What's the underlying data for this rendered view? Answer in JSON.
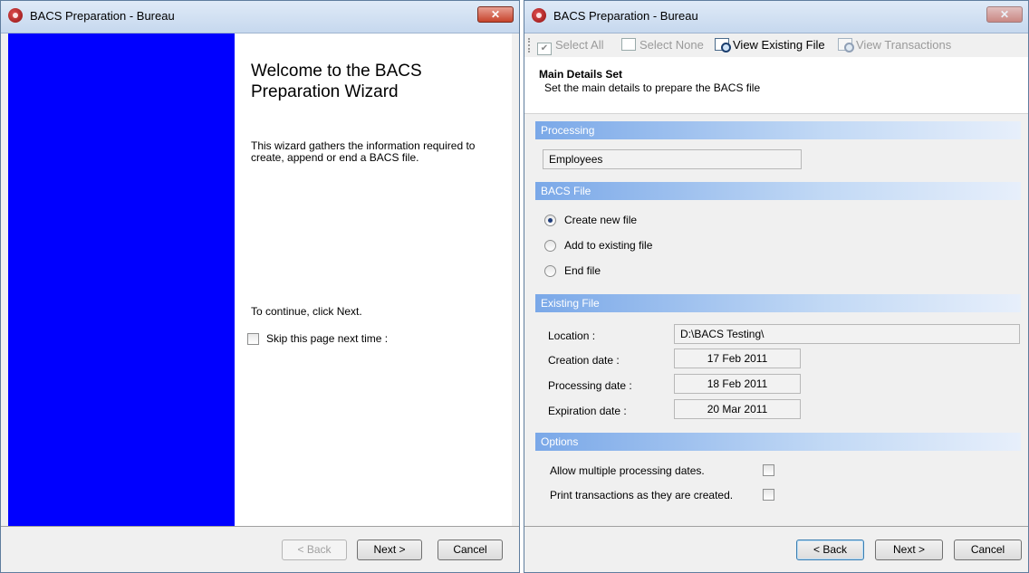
{
  "left_window": {
    "title": "BACS Preparation - Bureau",
    "close_label": "✕",
    "wizard_title": "Welcome to the BACS Preparation Wizard",
    "description": "This wizard gathers the information required to create, append or end a BACS file.",
    "continue_text": "To continue, click Next.",
    "skip_label": "Skip this page next time :",
    "skip_checked": false,
    "buttons": {
      "back": "< Back",
      "next": "Next >",
      "cancel": "Cancel"
    }
  },
  "right_window": {
    "title": "BACS Preparation - Bureau",
    "close_label": "✕",
    "toolbar": {
      "select_all": "Select All",
      "select_none": "Select None",
      "view_existing_file": "View Existing File",
      "view_transactions": "View Transactions"
    },
    "header": {
      "title": "Main Details Set",
      "subtitle": "Set the main details to prepare the BACS file"
    },
    "processing": {
      "section_label": "Processing",
      "value": "Employees"
    },
    "bacs_file": {
      "section_label": "BACS File",
      "options": [
        "Create new file",
        "Add to existing file",
        "End file"
      ],
      "selected": "Create new file"
    },
    "existing_file": {
      "section_label": "Existing File",
      "location_label": "Location :",
      "location_value": "D:\\BACS Testing\\",
      "creation_label": "Creation date :",
      "creation_value": "17 Feb 2011",
      "processing_label": "Processing date :",
      "processing_value": "18 Feb 2011",
      "expiration_label": "Expiration date :",
      "expiration_value": "20 Mar 2011"
    },
    "options": {
      "section_label": "Options",
      "allow_multiple_label": "Allow multiple processing dates.",
      "allow_multiple_checked": false,
      "print_transactions_label": "Print transactions as they are created.",
      "print_transactions_checked": false
    },
    "buttons": {
      "back": "< Back",
      "next": "Next >",
      "cancel": "Cancel"
    }
  },
  "colors": {
    "wizard_side_panel": "#0000ff",
    "section_header_start": "#7aa8e8",
    "titlebar": "#c6d8ee"
  }
}
